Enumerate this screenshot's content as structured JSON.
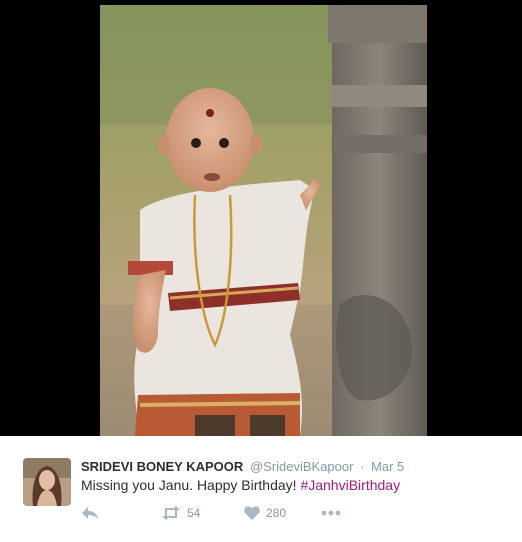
{
  "tweet": {
    "author_name": "SRIDEVI BONEY KAPOOR",
    "handle": "@SrideviBKapoor",
    "separator": "·",
    "time": "Mar 5",
    "text": "Missing you Janu. Happy Birthday! ",
    "hashtag": "#JanhviBirthday",
    "retweet_count": "54",
    "like_count": "280"
  },
  "icons": {
    "reply": "reply-icon",
    "retweet": "retweet-icon",
    "like": "heart-icon",
    "more": "more-dots-icon"
  },
  "colors": {
    "name": "#292f33",
    "meta": "#8899a6",
    "hashtag": "#9e1a7f",
    "media_background": "#000000"
  }
}
